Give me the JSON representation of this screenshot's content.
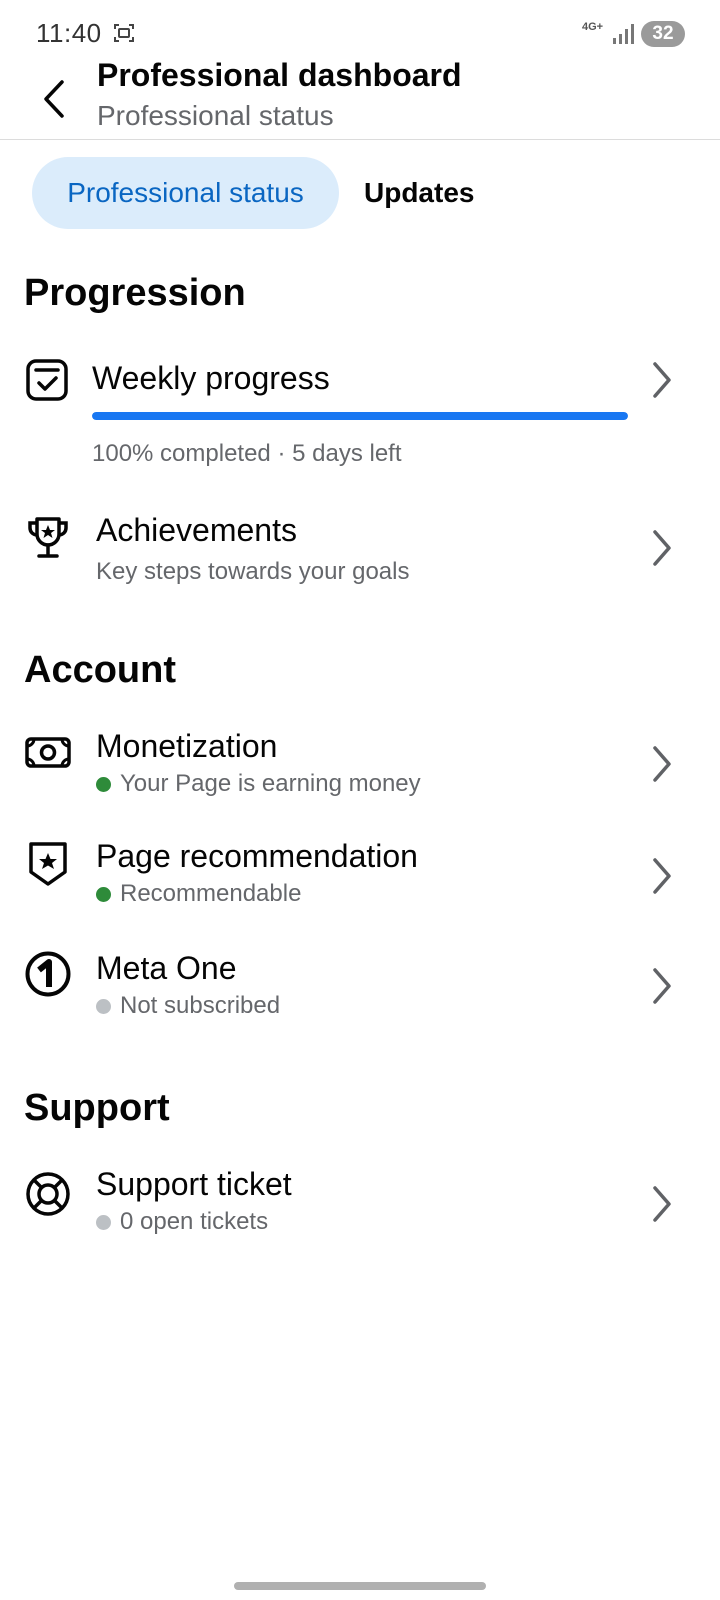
{
  "status_bar": {
    "time": "11:40",
    "network": "4G+",
    "battery": "32",
    "icons": [
      "screen-record-icon",
      "signal-icon"
    ]
  },
  "header": {
    "title": "Professional dashboard",
    "subtitle": "Professional status",
    "back_icon": "back-arrow-icon"
  },
  "tabs": [
    {
      "label": "Professional status",
      "active": true
    },
    {
      "label": "Updates",
      "active": false
    }
  ],
  "progression": {
    "heading": "Progression",
    "weekly": {
      "title": "Weekly progress",
      "progress_percent": 100,
      "caption": "100% completed · 5 days left",
      "icon": "checklist-icon"
    },
    "achievements": {
      "title": "Achievements",
      "subtitle": "Key steps towards your goals",
      "icon": "trophy-icon"
    }
  },
  "account": {
    "heading": "Account",
    "items": [
      {
        "title": "Monetization",
        "status": "Your Page is earning money",
        "status_color": "#2e8b3a",
        "icon": "money-icon"
      },
      {
        "title": "Page recommendation",
        "status": "Recommendable",
        "status_color": "#2e8b3a",
        "icon": "badge-star-icon"
      },
      {
        "title": "Meta One",
        "status": "Not subscribed",
        "status_color": "#bcc0c4",
        "icon": "meta-one-icon"
      }
    ]
  },
  "support": {
    "heading": "Support",
    "items": [
      {
        "title": "Support ticket",
        "status": "0 open tickets",
        "status_color": "#bcc0c4",
        "icon": "lifebuoy-icon"
      }
    ]
  },
  "colors": {
    "accent": "#1877f2",
    "tab_active_bg": "#dbecfb",
    "tab_active_text": "#0a66c2",
    "secondary_text": "#65676b"
  }
}
